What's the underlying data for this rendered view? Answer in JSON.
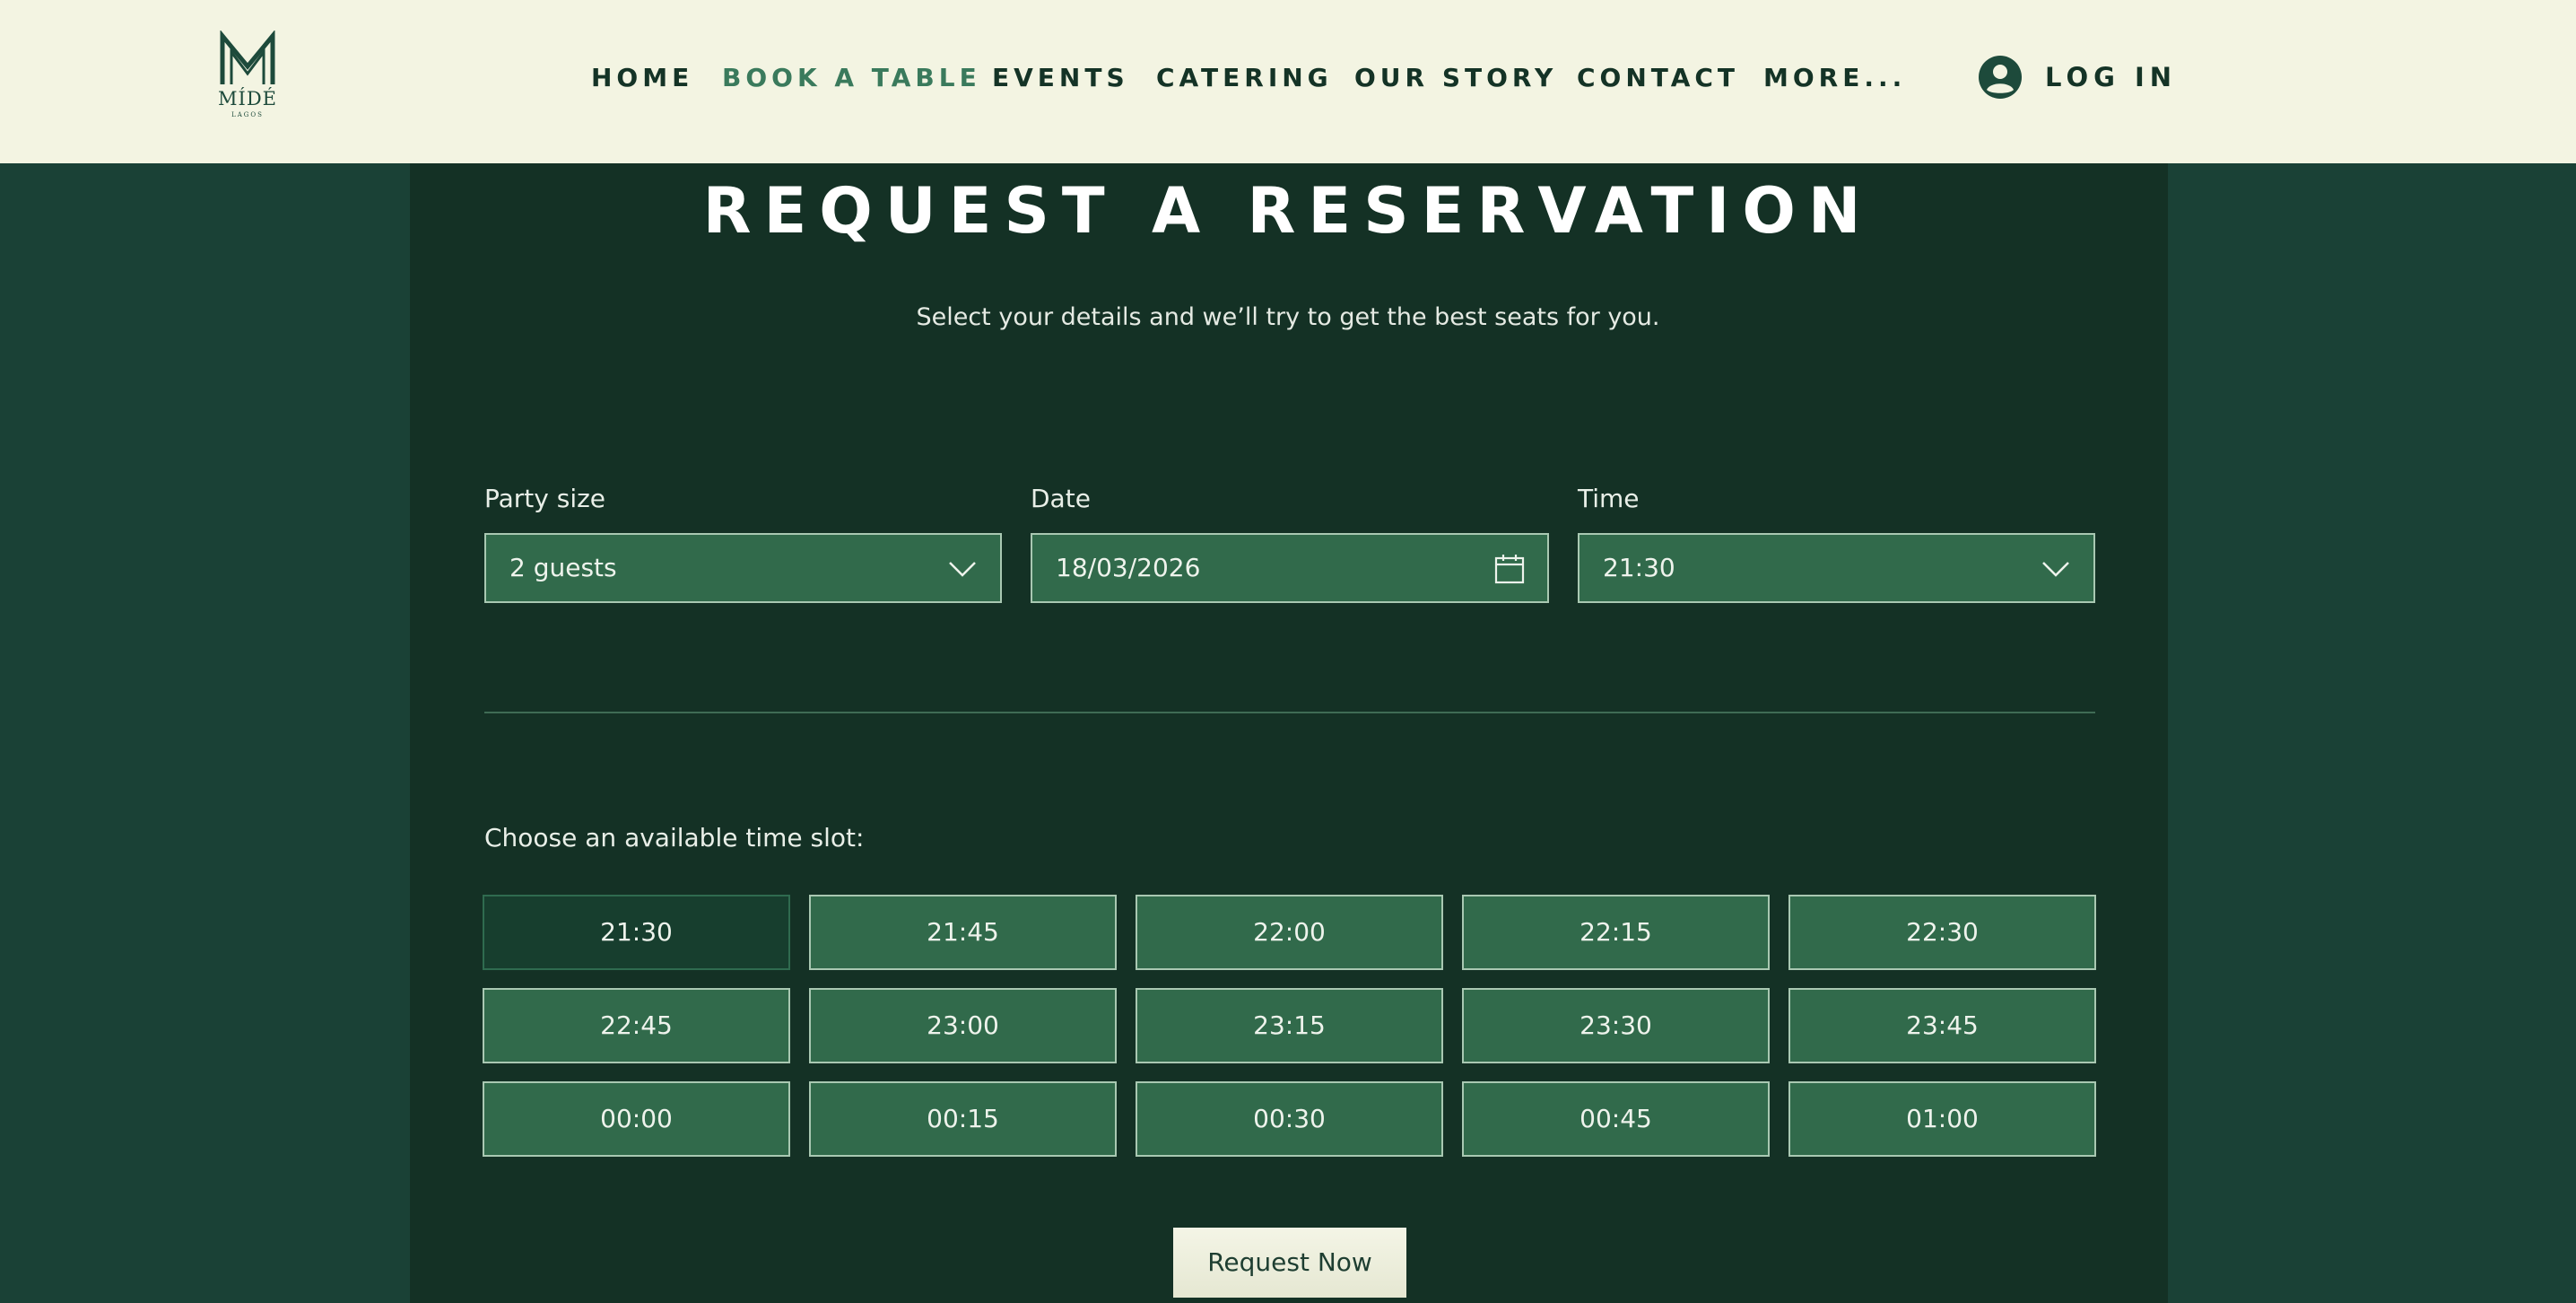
{
  "brand": {
    "name": "MÍDÉ",
    "sub": "LAGOS"
  },
  "nav": {
    "items": [
      "HOME",
      "BOOK A TABLE",
      "EVENTS",
      "CATERING",
      "OUR STORY",
      "CONTACT",
      "MORE..."
    ],
    "active": "BOOK A TABLE",
    "login_label": "LOG IN"
  },
  "page": {
    "title": "REQUEST A RESERVATION",
    "subtitle": "Select your details and we’ll try to get the best seats for you."
  },
  "form": {
    "party_size": {
      "label": "Party size",
      "value": "2 guests"
    },
    "date": {
      "label": "Date",
      "value": "18/03/2026"
    },
    "time": {
      "label": "Time",
      "value": "21:30"
    }
  },
  "slots": {
    "prompt": "Choose an available time slot:",
    "times": [
      "21:30",
      "21:45",
      "22:00",
      "22:15",
      "22:30",
      "22:45",
      "23:00",
      "23:15",
      "23:30",
      "23:45",
      "00:00",
      "00:15",
      "00:30",
      "00:45",
      "01:00"
    ],
    "selected": "21:30"
  },
  "submit_label": "Request Now",
  "colors": {
    "header_bg": "#f3f4e2",
    "page_bg": "#1a4136",
    "panel_bg": "#143125",
    "field_bg": "#316a4b",
    "accent": "#3a7a5c"
  },
  "icons": {
    "user": "user-circle-icon",
    "calendar": "calendar-icon",
    "dropdown": "chevron-down-icon"
  }
}
